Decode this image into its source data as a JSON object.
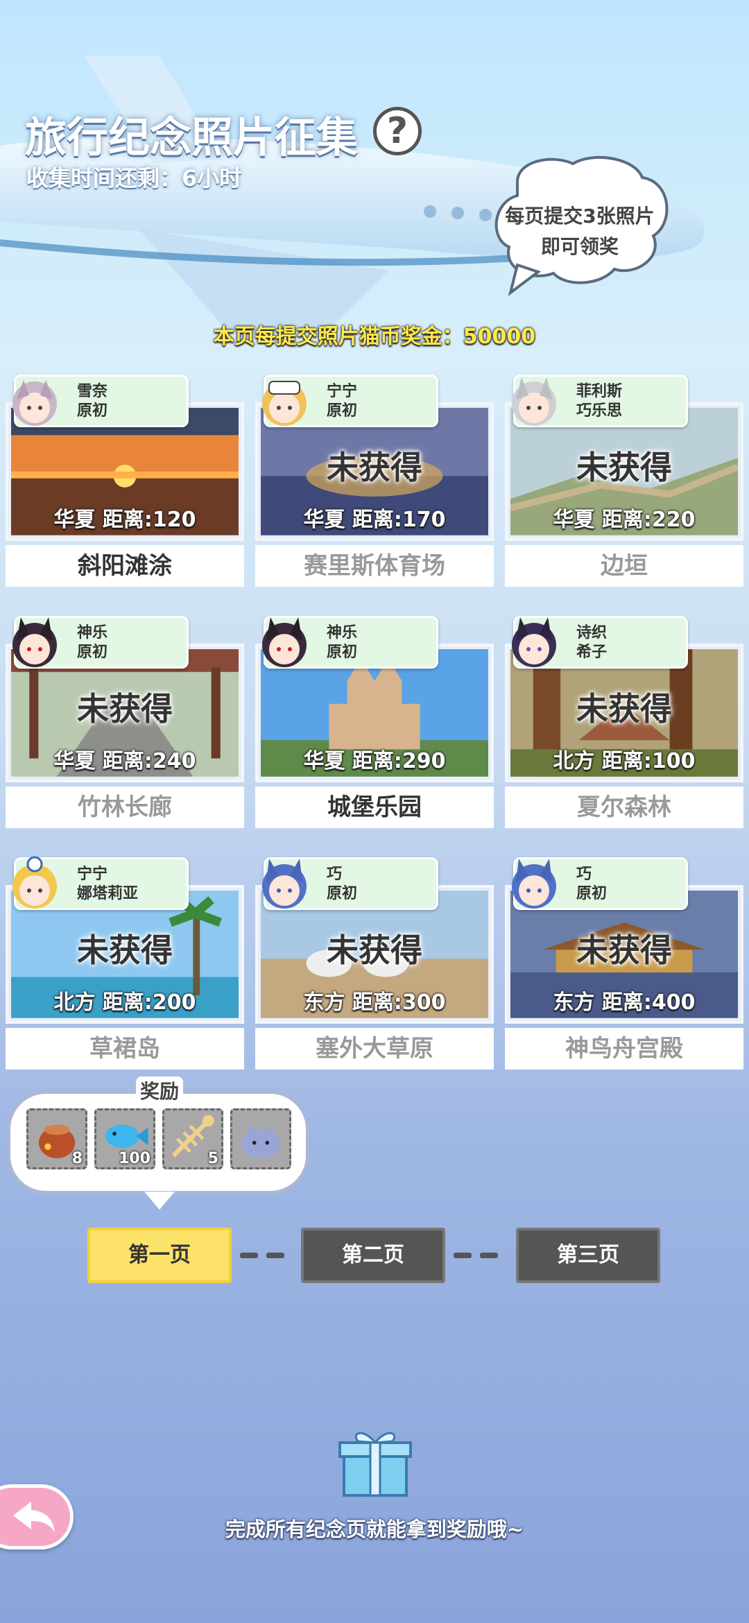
{
  "header": {
    "title": "旅行纪念照片征集",
    "help_symbol": "?",
    "time_label": "收集时间还剩：6小时",
    "bubble_line1": "每页提交3张照片",
    "bubble_line2": "即可领奖",
    "bonus_text": "本页每提交照片猫币奖金：50000"
  },
  "cards": [
    {
      "tag_line1": "雪奈",
      "tag_line2": "原初",
      "locked": "",
      "info": "华夏  距离:120",
      "name": "斜阳滩涂",
      "owned": true
    },
    {
      "tag_line1": "宁宁",
      "tag_line2": "原初",
      "locked": "未获得",
      "info": "华夏  距离:170",
      "name": "赛里斯体育场",
      "owned": false
    },
    {
      "tag_line1": "菲利斯",
      "tag_line2": "巧乐思",
      "locked": "未获得",
      "info": "华夏  距离:220",
      "name": "边垣",
      "owned": false
    },
    {
      "tag_line1": "神乐",
      "tag_line2": "原初",
      "locked": "未获得",
      "info": "华夏  距离:240",
      "name": "竹林长廊",
      "owned": false
    },
    {
      "tag_line1": "神乐",
      "tag_line2": "原初",
      "locked": "",
      "info": "华夏  距离:290",
      "name": "城堡乐园",
      "owned": true
    },
    {
      "tag_line1": "诗织",
      "tag_line2": "希子",
      "locked": "未获得",
      "info": "北方  距离:100",
      "name": "夏尔森林",
      "owned": false
    },
    {
      "tag_line1": "宁宁",
      "tag_line2": "娜塔莉亚",
      "locked": "未获得",
      "info": "北方  距离:200",
      "name": "草裙岛",
      "owned": false
    },
    {
      "tag_line1": "巧",
      "tag_line2": "原初",
      "locked": "未获得",
      "info": "东方  距离:300",
      "name": "塞外大草原",
      "owned": false
    },
    {
      "tag_line1": "巧",
      "tag_line2": "原初",
      "locked": "未获得",
      "info": "东方  距离:400",
      "name": "神鸟舟宫殿",
      "owned": false
    }
  ],
  "rewards": {
    "title": "奖励",
    "items": [
      {
        "icon": "treasure-pot-icon",
        "qty": "8"
      },
      {
        "icon": "blue-fish-icon",
        "qty": "100"
      },
      {
        "icon": "fish-bone-icon",
        "qty": "5"
      },
      {
        "icon": "cat-plush-icon",
        "qty": ""
      }
    ]
  },
  "pages": {
    "page1": "第一页",
    "page2": "第二页",
    "page3": "第三页",
    "active": 1
  },
  "footer": {
    "text": "完成所有纪念页就能拿到奖励哦~"
  },
  "colors": {
    "tag_bg": "#e2f7e4",
    "active_page": "#fde26a",
    "inactive_page": "#555555",
    "bonus_text": "#ffe94a"
  }
}
